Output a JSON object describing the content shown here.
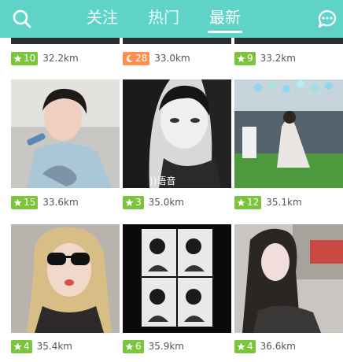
{
  "tabs": [
    {
      "label": "关注",
      "active": false
    },
    {
      "label": "热门",
      "active": false
    },
    {
      "label": "最新",
      "active": true
    }
  ],
  "cards": [
    {
      "badge": "10",
      "badge_color": "green",
      "badge_icon": "star-icon",
      "distance": "32.2km"
    },
    {
      "badge": "28",
      "badge_color": "orange",
      "badge_icon": "moon-icon",
      "distance": "33.0km"
    },
    {
      "badge": "9",
      "badge_color": "green",
      "badge_icon": "star-icon",
      "distance": "33.2km"
    },
    {
      "badge": "15",
      "badge_color": "green",
      "badge_icon": "star-icon",
      "distance": "33.6km"
    },
    {
      "badge": "3",
      "badge_color": "green",
      "badge_icon": "star-icon",
      "distance": "35.0km",
      "overlay_text": "))语音"
    },
    {
      "badge": "12",
      "badge_color": "green",
      "badge_icon": "star-icon",
      "distance": "35.1km"
    },
    {
      "badge": "4",
      "badge_color": "green",
      "badge_icon": "star-icon",
      "distance": "35.4km"
    },
    {
      "badge": "6",
      "badge_color": "green",
      "badge_icon": "star-icon",
      "distance": "35.9km"
    },
    {
      "badge": "4",
      "badge_color": "green",
      "badge_icon": "star-icon",
      "distance": "36.6km"
    }
  ],
  "colors": {
    "header": "#5fd3c8",
    "badge_green": "#7bc43b",
    "badge_orange": "#ff8f4f"
  }
}
